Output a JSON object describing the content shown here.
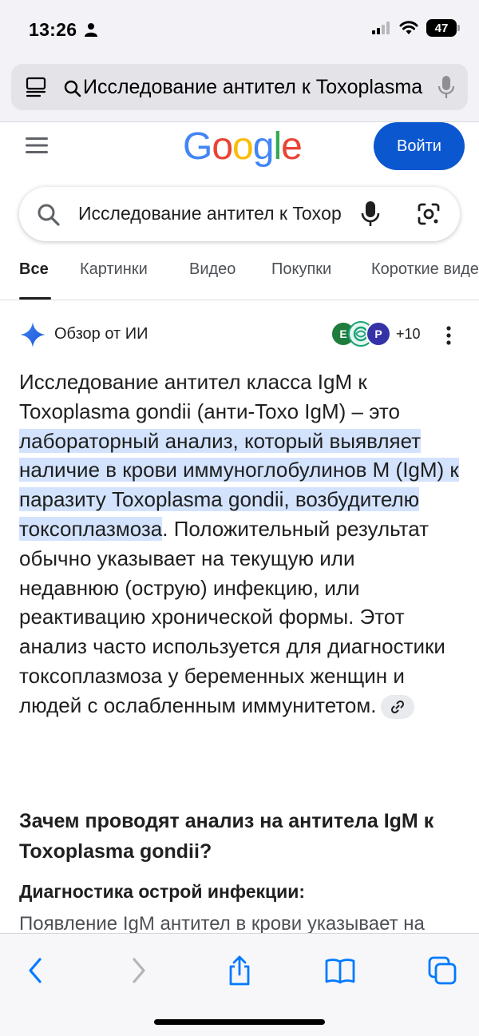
{
  "status_bar": {
    "time": "13:26",
    "battery": "47"
  },
  "address_bar": {
    "text": "Исследование антител к Toxoplasma"
  },
  "header": {
    "logo_letters": [
      {
        "char": "G",
        "color": "#4285F4"
      },
      {
        "char": "o",
        "color": "#EA4335"
      },
      {
        "char": "o",
        "color": "#FBBC05"
      },
      {
        "char": "g",
        "color": "#4285F4"
      },
      {
        "char": "l",
        "color": "#34A853"
      },
      {
        "char": "e",
        "color": "#EA4335"
      }
    ],
    "signin_label": "Войти"
  },
  "search": {
    "query": "Исследование антител к Toxoplasma"
  },
  "tabs": [
    "Все",
    "Картинки",
    "Видео",
    "Покупки",
    "Короткие видео"
  ],
  "ai_overview": {
    "title": "Обзор от ИИ",
    "sources_more": "+10",
    "source_badges": [
      "E",
      "",
      "P"
    ],
    "intro_plain": "Исследование антител класса IgM к Toxoplasma gondii (анти-Toxo IgM) – это ",
    "intro_highlight": "лабораторный анализ, который выявляет наличие в крови иммуноглобулинов M (IgM) к паразиту Toxoplasma gondii, возбудителю токсоплазмоза",
    "intro_rest": ". Положительный результат обычно указывает на текущую или недавнюю (острую) инфекцию, или реактивацию хронической формы. Этот анализ часто используется для диагностики токсоплазмоза у беременных женщин и людей с ослабленным иммунитетом.",
    "heading": "Зачем проводят анализ на антитела IgM к Toxoplasma gondii?",
    "subheading": "Диагностика острой инфекции:",
    "cut_text": "Появление IgM антител в крови указывает на"
  },
  "colors": {
    "accent": "#0b57d0",
    "highlight": "#d3e3fd",
    "safari_blue": "#007aff"
  }
}
